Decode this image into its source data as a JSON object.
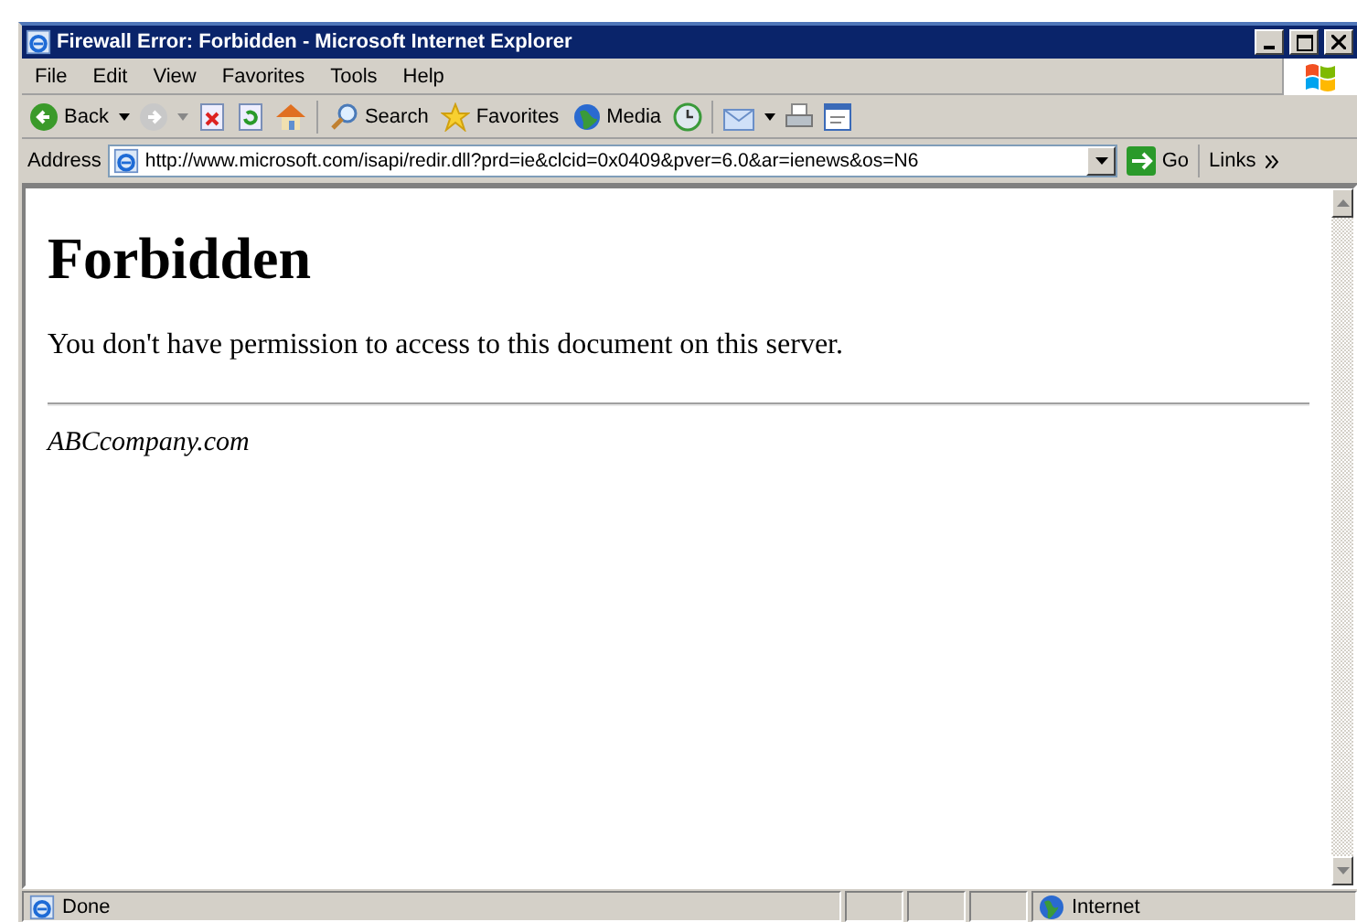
{
  "window": {
    "title": "Firewall Error: Forbidden - Microsoft Internet Explorer"
  },
  "menu": [
    {
      "label": "File"
    },
    {
      "label": "Edit"
    },
    {
      "label": "View"
    },
    {
      "label": "Favorites"
    },
    {
      "label": "Tools"
    },
    {
      "label": "Help"
    }
  ],
  "toolbar": {
    "back": "Back",
    "search": "Search",
    "favorites": "Favorites",
    "media": "Media"
  },
  "address": {
    "label": "Address",
    "value": "http://www.microsoft.com/isapi/redir.dll?prd=ie&clcid=0x0409&pver=6.0&ar=ienews&os=N6",
    "go": "Go",
    "links": "Links"
  },
  "page": {
    "heading": "Forbidden",
    "message": "You don't have permission to access to this document on this server.",
    "footer": "ABCcompany.com"
  },
  "status_bar": {
    "text": "Done",
    "zone": "Internet"
  }
}
